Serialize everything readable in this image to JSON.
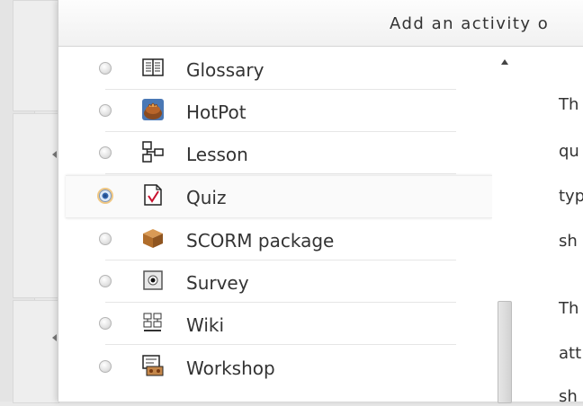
{
  "dialog": {
    "title": "Add an activity o"
  },
  "activities": [
    {
      "label": "Glossary",
      "icon": "glossary-icon",
      "checked": false
    },
    {
      "label": "HotPot",
      "icon": "hotpot-icon",
      "checked": false
    },
    {
      "label": "Lesson",
      "icon": "lesson-icon",
      "checked": false
    },
    {
      "label": "Quiz",
      "icon": "quiz-icon",
      "checked": true
    },
    {
      "label": "SCORM package",
      "icon": "scorm-package-icon",
      "checked": false
    },
    {
      "label": "Survey",
      "icon": "survey-icon",
      "checked": false
    },
    {
      "label": "Wiki",
      "icon": "wiki-icon",
      "checked": false
    },
    {
      "label": "Workshop",
      "icon": "workshop-icon",
      "checked": false
    }
  ],
  "description": {
    "paragraph1": [
      "Th",
      "qu",
      "typ",
      "sh"
    ],
    "paragraph2": [
      "Th",
      "att",
      "sh"
    ]
  },
  "colors": {
    "selected_radio": "#3a6fb8",
    "focus_ring": "#f0c783"
  }
}
